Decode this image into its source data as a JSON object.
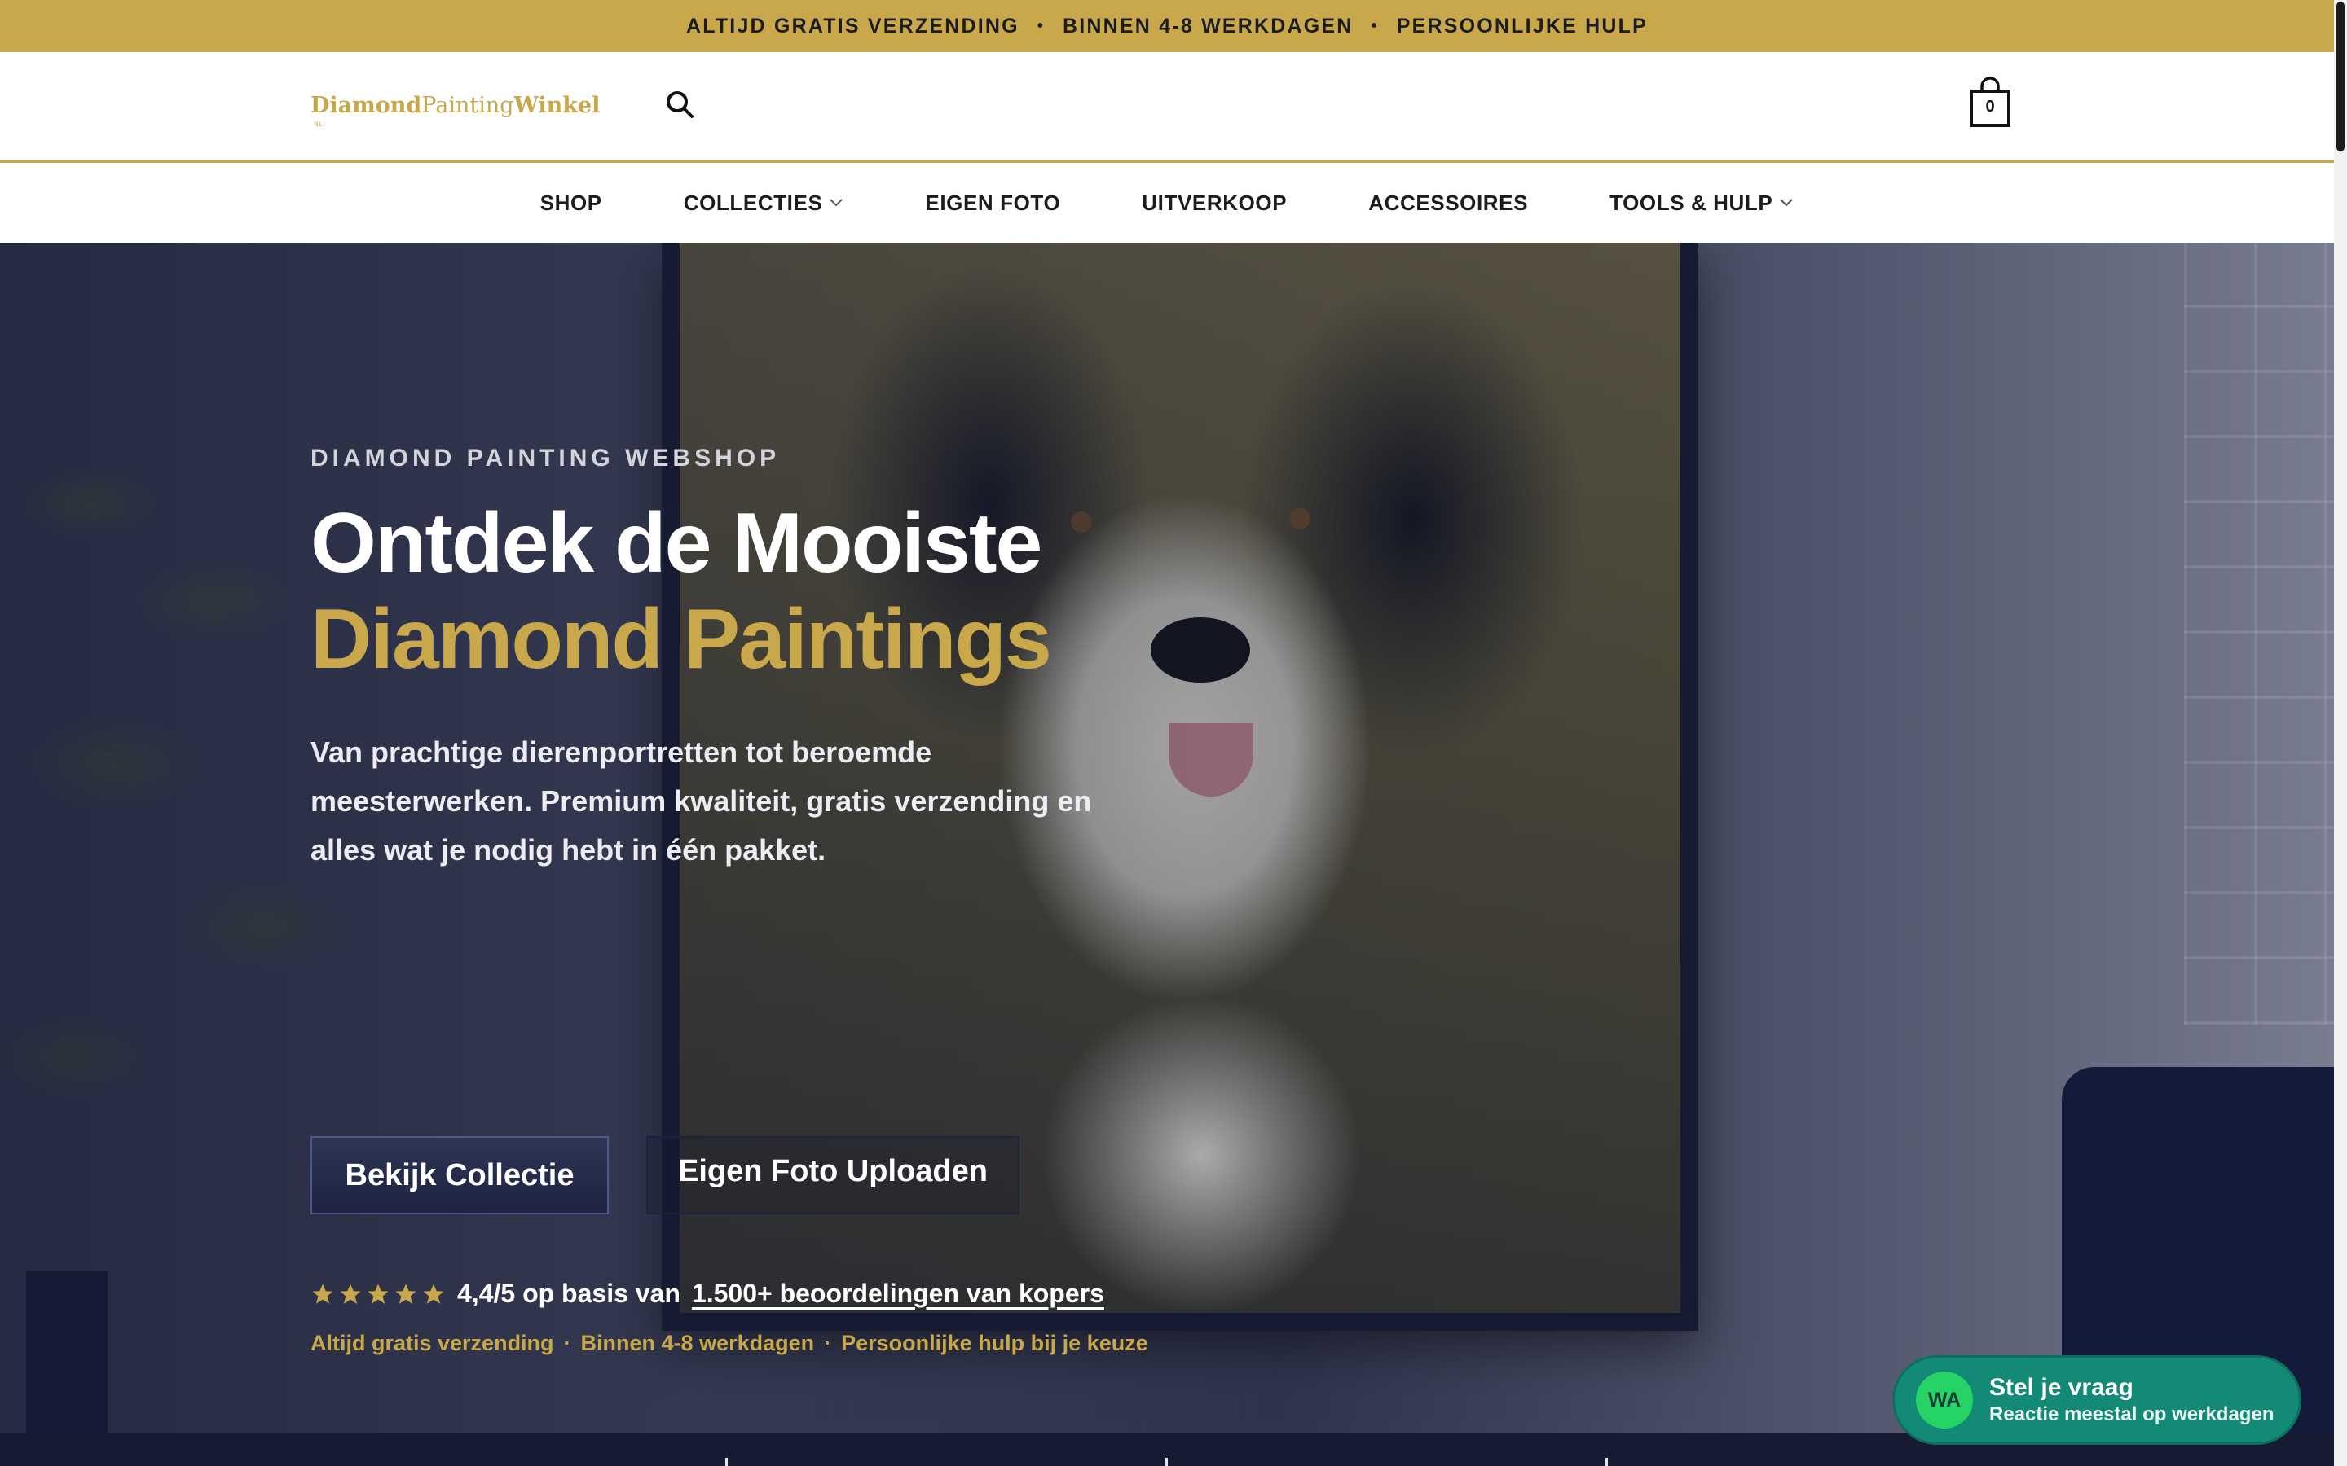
{
  "announcement": {
    "items": [
      "ALTIJD GRATIS VERZENDING",
      "BINNEN 4-8 WERKDAGEN",
      "PERSOONLIJKE HULP"
    ],
    "separator": "•"
  },
  "header": {
    "logo": {
      "part1": "Diamond",
      "part2": "Painting",
      "part3": "Winkel",
      "tagline": "NL"
    },
    "search_icon": "search-icon",
    "cart": {
      "icon": "shopping-bag-icon",
      "count": "0"
    }
  },
  "nav": {
    "items": [
      {
        "label": "SHOP",
        "has_dropdown": false
      },
      {
        "label": "COLLECTIES",
        "has_dropdown": true
      },
      {
        "label": "EIGEN FOTO",
        "has_dropdown": false
      },
      {
        "label": "UITVERKOOP",
        "has_dropdown": false
      },
      {
        "label": "ACCESSOIRES",
        "has_dropdown": false
      },
      {
        "label": "TOOLS & HULP",
        "has_dropdown": true
      }
    ]
  },
  "hero": {
    "eyebrow": "DIAMOND PAINTING WEBSHOP",
    "headline_line1": "Ontdek de Mooiste",
    "headline_line2": "Diamond Paintings",
    "subtext": "Van prachtige dierenportretten tot beroemde meesterwerken. Premium kwaliteit, gratis verzending en alles wat je nodig hebt in één pakket.",
    "primary_button": "Bekijk Collectie",
    "secondary_button": "Eigen Foto Uploaden",
    "rating": {
      "stars": 5,
      "score_text": "4,4/5 op basis van",
      "link_text": "1.500+ beoordelingen van kopers"
    },
    "usps": [
      "Altijd gratis verzending",
      "Binnen 4-8 werkdagen",
      "Persoonlijke hulp bij je keuze"
    ],
    "usp_separator": "·"
  },
  "whatsapp": {
    "badge": "WA",
    "title": "Stel je vraag",
    "subtitle": "Reactie meestal op werkdagen"
  },
  "colors": {
    "gold": "#c8a84a",
    "navy": "#161b33",
    "whatsapp_green": "#128a76"
  }
}
